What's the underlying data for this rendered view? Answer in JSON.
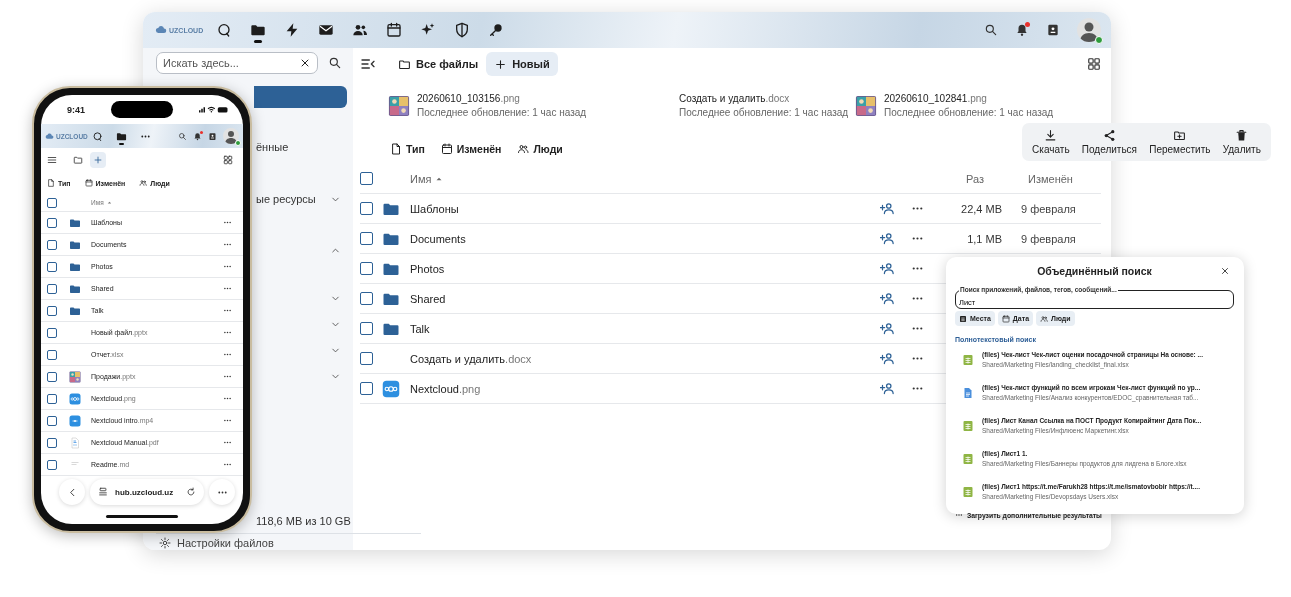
{
  "browser": {
    "header": {
      "logo": "UZCLOUD",
      "apps": [
        {
          "kind": "dashboard",
          "selected": false
        },
        {
          "kind": "files",
          "selected": true
        },
        {
          "kind": "activity",
          "selected": false
        },
        {
          "kind": "mail",
          "selected": false
        },
        {
          "kind": "contacts",
          "selected": false
        },
        {
          "kind": "calendar",
          "selected": false
        },
        {
          "kind": "assistant",
          "selected": false
        },
        {
          "kind": "shield",
          "selected": false
        },
        {
          "kind": "key",
          "selected": false
        }
      ],
      "notifications_unread": true,
      "user_online": true
    },
    "sidebar": {
      "search": {
        "placeholder": "Искать здесь..."
      },
      "nav_items": [
        {
          "selected": true
        },
        {
          "label": "ённые",
          "selected": false
        }
      ],
      "sections": [
        {
          "label": "ые ресурсы",
          "expanded": false
        },
        {
          "expanded": true
        },
        {
          "expanded": false
        },
        {
          "expanded": false
        },
        {
          "expanded": false
        },
        {
          "expanded": false
        }
      ],
      "storage": "118,6 MB из 10 GB",
      "settings": "Настройки файлов"
    },
    "toolbar": {
      "breadcrumb": "Все файлы",
      "new_button": "Новый"
    },
    "recent": [
      {
        "name": "20260610_103156",
        "ext": ".png",
        "kind": "image",
        "subtitle": "Последнее обновление: 1 час назад"
      },
      {
        "name": "Создать и удалить",
        "ext": ".docx",
        "kind": "none",
        "subtitle": "Последнее обновление: 1 час назад"
      },
      {
        "name": "20260610_102841",
        "ext": ".png",
        "kind": "image",
        "subtitle": "Последнее обновление: 1 час назад"
      }
    ],
    "filters": [
      {
        "label": "Тип",
        "kind": "type"
      },
      {
        "label": "Изменён",
        "kind": "date"
      },
      {
        "label": "Люди",
        "kind": "people"
      }
    ],
    "table": {
      "columns": [
        "Имя",
        "Раз",
        "Изменён"
      ],
      "select_all": false,
      "rows": [
        {
          "name": "Шаблоны",
          "kind": "folder",
          "size": "22,4 MB",
          "modified": "9 февраля",
          "checked": false
        },
        {
          "name": "Documents",
          "kind": "folder",
          "size": "1,1 MB",
          "modified": "9 февраля",
          "checked": false
        },
        {
          "name": "Photos",
          "kind": "folder",
          "checked": false
        },
        {
          "name": "Shared",
          "kind": "folder",
          "checked": false
        },
        {
          "name": "Talk",
          "kind": "folder",
          "checked": false
        },
        {
          "name": "Создать и удалить",
          "ext": ".docx",
          "kind": "none",
          "checked": false
        },
        {
          "name": "Nextcloud",
          "ext": ".png",
          "kind": "logo",
          "checked": false
        }
      ]
    }
  },
  "selection_actions": [
    {
      "label": "Скачать",
      "kind": "download"
    },
    {
      "label": "Поделиться",
      "kind": "share"
    },
    {
      "label": "Переместить",
      "kind": "move"
    },
    {
      "label": "Удалить",
      "kind": "delete"
    }
  ],
  "unified_search": {
    "title": "Объединённый поиск",
    "field": {
      "label": "Поиск приложений, файлов, тегов, сообщений...",
      "value": "Лист"
    },
    "filters": [
      {
        "label": "Места",
        "kind": "places"
      },
      {
        "label": "Дата",
        "kind": "date"
      },
      {
        "label": "Люди",
        "kind": "people"
      }
    ],
    "section": "Полнотекстовый поиск",
    "results": [
      {
        "title": "(files) Чек-лист Чек-лист оценки посадочной страницы На основе: ...",
        "path": "Shared/Marketing Files/landing_checklist_final.xlsx",
        "kind": "sheet"
      },
      {
        "title": "(files) Чек-лист функций по всем игрокам Чек-лист функций по ур...",
        "path": "Shared/Marketing Files/Анализ конкурентов/EDOC_сравнительная таб...",
        "kind": "doc"
      },
      {
        "title": "(files) Лист Канал Ссылка на ПОСТ Продукт Копирайтинг Дата Пок...",
        "path": "Shared/Marketing Files/Инфлюенс Маркетинг.xlsx",
        "kind": "sheet"
      },
      {
        "title": "(files) Лист1 1.",
        "path": "Shared/Marketing Files/Баннеры продуктов для лидгена в Блоге.xlsx",
        "kind": "sheet"
      },
      {
        "title": "(files) Лист1 https://t.me/Farukh28 https://t.me/ismatovbobir https://t....",
        "path": "Shared/Marketing Files/Devopsdays Users.xlsx",
        "kind": "sheet"
      }
    ],
    "more": "Загрузить дополнительные результаты"
  },
  "phone": {
    "time": "9:41",
    "header": {
      "logo": "UZCLOUD",
      "apps": [
        {
          "kind": "dashboard",
          "selected": false
        },
        {
          "kind": "files",
          "selected": true
        },
        {
          "kind": "more",
          "selected": false
        }
      ],
      "notifications_unread": true,
      "user_online": true
    },
    "filters": [
      {
        "label": "Тип",
        "kind": "type"
      },
      {
        "label": "Изменён",
        "kind": "date"
      },
      {
        "label": "Люди",
        "kind": "people"
      }
    ],
    "column": "Имя",
    "select_all": false,
    "rows": [
      {
        "name": "Шаблоны",
        "kind": "folder",
        "checked": false
      },
      {
        "name": "Documents",
        "kind": "folder",
        "checked": false
      },
      {
        "name": "Photos",
        "kind": "folder",
        "checked": false
      },
      {
        "name": "Shared",
        "kind": "folder",
        "checked": false
      },
      {
        "name": "Talk",
        "kind": "folder",
        "checked": false
      },
      {
        "name": "Новый файл",
        "ext": ".pptx",
        "kind": "none",
        "checked": false
      },
      {
        "name": "Отчет",
        "ext": ".xlsx",
        "kind": "none",
        "checked": false
      },
      {
        "name": "Продажи",
        "ext": ".pptx",
        "kind": "image",
        "checked": false
      },
      {
        "name": "Nextcloud",
        "ext": ".png",
        "kind": "logo",
        "checked": false
      },
      {
        "name": "Nextcloud intro",
        "ext": ".mp4",
        "kind": "video",
        "checked": false
      },
      {
        "name": "Nextcloud Manual",
        "ext": ".pdf",
        "kind": "pdf",
        "checked": false
      },
      {
        "name": "Readme",
        "ext": ".md",
        "kind": "text",
        "checked": false
      }
    ],
    "url": "hub.uzcloud.uz"
  }
}
